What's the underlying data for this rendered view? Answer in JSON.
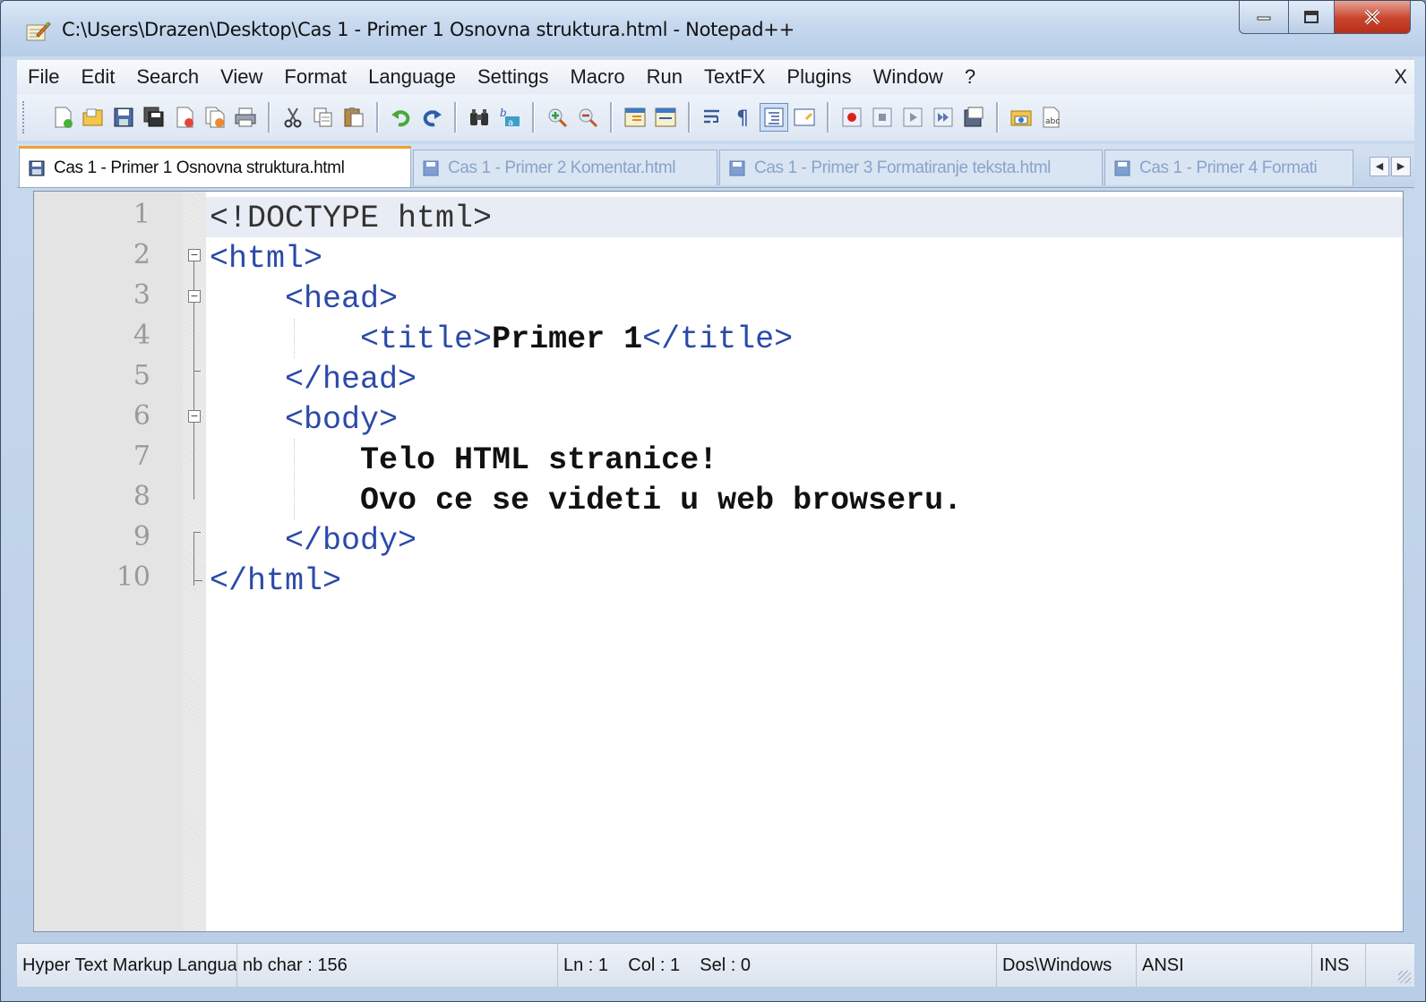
{
  "window": {
    "title": "C:\\Users\\Drazen\\Desktop\\Cas 1 - Primer 1 Osnovna struktura.html - Notepad++"
  },
  "menu": {
    "items": [
      "File",
      "Edit",
      "Search",
      "View",
      "Format",
      "Language",
      "Settings",
      "Macro",
      "Run",
      "TextFX",
      "Plugins",
      "Window",
      "?"
    ],
    "close_label": "X"
  },
  "toolbar": {
    "buttons": [
      "new-file",
      "open-file",
      "save",
      "save-all",
      "close",
      "close-all",
      "print",
      "cut",
      "copy",
      "paste",
      "undo",
      "redo",
      "find",
      "replace",
      "zoom-in",
      "zoom-out",
      "sync-vertical",
      "sync-horizontal",
      "word-wrap",
      "show-all-chars",
      "indent-guide",
      "user-defined-language",
      "record-macro",
      "stop-recording",
      "playback",
      "run-macro-multiple",
      "save-macro",
      "launch-in-browser",
      "spell-check"
    ]
  },
  "tabs": [
    {
      "label": "Cas 1 - Primer 1 Osnovna struktura.html",
      "active": true
    },
    {
      "label": "Cas 1 - Primer 2 Komentar.html",
      "active": false
    },
    {
      "label": "Cas 1 - Primer 3 Formatiranje teksta.html",
      "active": false
    },
    {
      "label": "Cas 1 - Primer 4 Formati",
      "active": false
    }
  ],
  "editor": {
    "lines": [
      {
        "num": "1",
        "segments": [
          {
            "t": "<!DOCTYPE html>",
            "c": "doctype"
          }
        ]
      },
      {
        "num": "2",
        "segments": [
          {
            "t": "<html>",
            "c": "tag"
          }
        ]
      },
      {
        "num": "3",
        "segments": [
          {
            "t": "    ",
            "c": ""
          },
          {
            "t": "<head>",
            "c": "tag"
          }
        ]
      },
      {
        "num": "4",
        "segments": [
          {
            "t": "        ",
            "c": ""
          },
          {
            "t": "<title>",
            "c": "tag"
          },
          {
            "t": "Primer 1",
            "c": "txt"
          },
          {
            "t": "</title>",
            "c": "tag"
          }
        ]
      },
      {
        "num": "5",
        "segments": [
          {
            "t": "    ",
            "c": ""
          },
          {
            "t": "</head>",
            "c": "tag"
          }
        ]
      },
      {
        "num": "6",
        "segments": [
          {
            "t": "    ",
            "c": ""
          },
          {
            "t": "<body>",
            "c": "tag"
          }
        ]
      },
      {
        "num": "7",
        "segments": [
          {
            "t": "        ",
            "c": ""
          },
          {
            "t": "Telo HTML stranice!",
            "c": "txt"
          }
        ]
      },
      {
        "num": "8",
        "segments": [
          {
            "t": "        ",
            "c": ""
          },
          {
            "t": "Ovo ce se videti u web browseru.",
            "c": "txt"
          }
        ]
      },
      {
        "num": "9",
        "segments": [
          {
            "t": "    ",
            "c": ""
          },
          {
            "t": "</body>",
            "c": "tag"
          }
        ]
      },
      {
        "num": "10",
        "segments": [
          {
            "t": "</html>",
            "c": "tag"
          }
        ]
      }
    ],
    "current_line": 1
  },
  "status": {
    "language": "Hyper Text Markup Language file",
    "chars": "nb char : 156",
    "position": "Ln : 1    Col : 1    Sel : 0",
    "eol": "Dos\\Windows",
    "encoding": "ANSI",
    "mode": "INS"
  },
  "colors": {
    "tag": "#2b4aa8",
    "active_tab_accent": "#f0a030",
    "current_line": "#e8ecf4",
    "gutter": "#e4e4e4"
  }
}
